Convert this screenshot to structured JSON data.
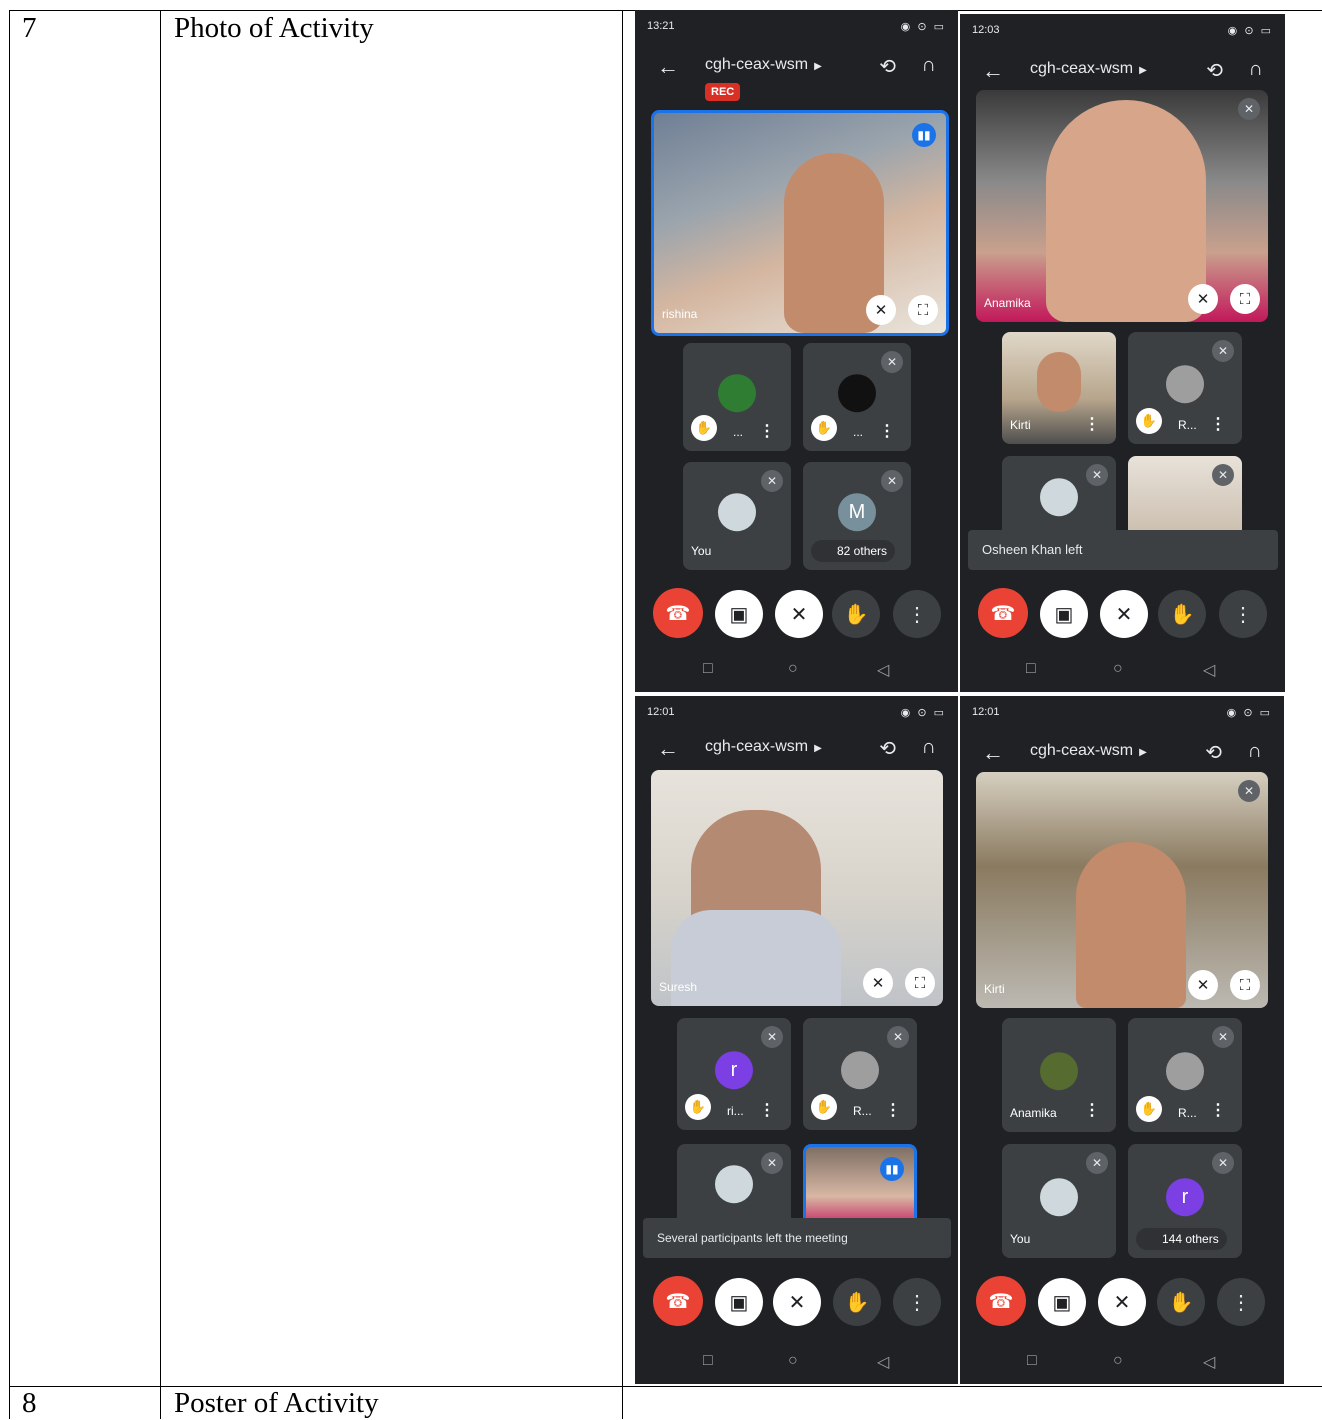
{
  "table": {
    "row7": {
      "num": "7",
      "label": "Photo of Activity"
    },
    "row8": {
      "num": "8",
      "label": "Poster of Activity"
    }
  },
  "colors": {
    "phone_bg": "#202124",
    "tile_bg": "#3c4043",
    "end_call": "#ea4335",
    "rec": "#d93025",
    "speaking": "#1a73e8"
  },
  "screens": [
    {
      "time": "13:21",
      "meeting": "cgh-ceax-wsm",
      "rec": "REC",
      "main_name": "rishina",
      "tiles": [
        {
          "name": "..."
        },
        {
          "name": "..."
        },
        {
          "name": "You"
        },
        {
          "name": "M",
          "others": "82 others"
        }
      ]
    },
    {
      "time": "12:03",
      "meeting": "cgh-ceax-wsm",
      "main_name": "Anamika",
      "tiles": [
        {
          "name": "Kirti"
        },
        {
          "name": "R..."
        },
        {
          "name": ""
        },
        {
          "name": ""
        }
      ],
      "toast": "Osheen Khan left"
    },
    {
      "time": "12:01",
      "meeting": "cgh-ceax-wsm",
      "main_name": "Suresh",
      "tiles": [
        {
          "name": "ri...",
          "letter": "r"
        },
        {
          "name": "R..."
        },
        {
          "name": ""
        },
        {
          "name": ""
        }
      ],
      "toast": "Several participants left the meeting"
    },
    {
      "time": "12:01",
      "meeting": "cgh-ceax-wsm",
      "main_name": "Kirti",
      "tiles": [
        {
          "name": "Anamika"
        },
        {
          "name": "R..."
        },
        {
          "name": "You"
        },
        {
          "name": "r",
          "others": "144 others"
        }
      ]
    }
  ]
}
